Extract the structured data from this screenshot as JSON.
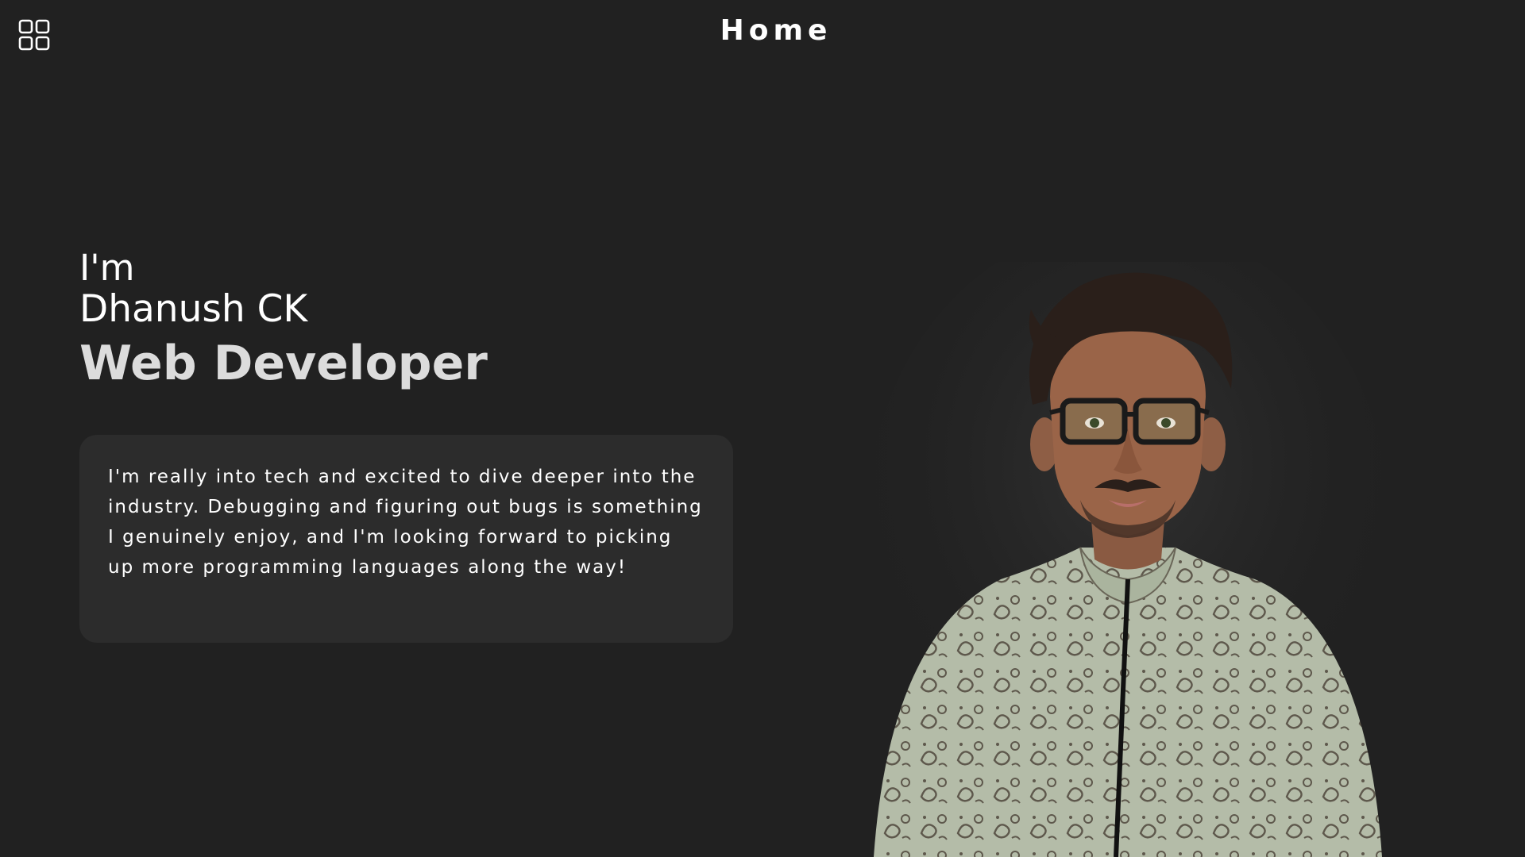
{
  "header": {
    "title": "Home",
    "menu_icon": "grid-menu-icon"
  },
  "hero": {
    "greeting": "I'm",
    "name": "Dhanush CK",
    "role": "Web Developer",
    "about": "I'm really into tech and excited to dive deeper into the industry. Debugging and figuring out bugs is something I genuinely enjoy, and I'm looking forward to picking up more programming languages along the way!",
    "photo_icon": "profile-photo"
  },
  "colors": {
    "background": "#212121",
    "card": "#2c2c2c",
    "text": "#ffffff",
    "role_text": "#dcdcdc"
  }
}
